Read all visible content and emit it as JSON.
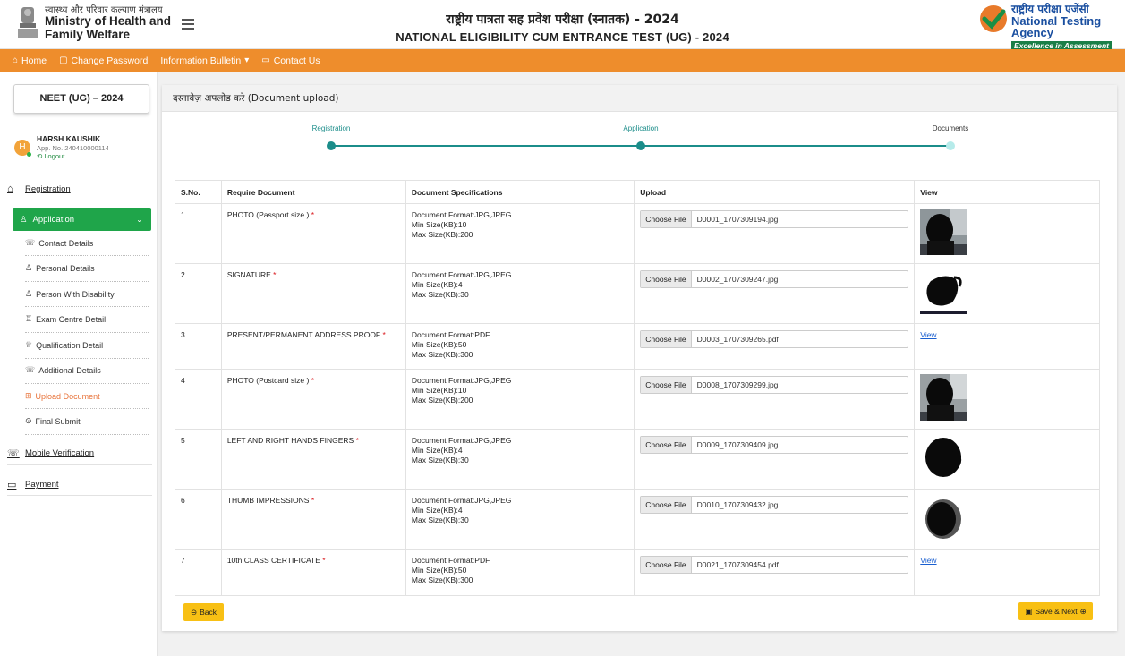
{
  "header": {
    "ministry_hi": "स्वास्थ्य और परिवार कल्याण मंत्रालय",
    "ministry_en1": "Ministry of Health and",
    "ministry_en2": "Family Welfare",
    "title_hi": "राष्ट्रीय पात्रता सह प्रवेश परीक्षा (स्नातक) - 2024",
    "title_en": "NATIONAL ELIGIBILITY CUM ENTRANCE TEST (UG) - 2024",
    "nta_hi": "राष्ट्रीय परीक्षा एजेंसी",
    "nta_en": "National Testing Agency",
    "nta_tagline": "Excellence in Assessment"
  },
  "topnav": {
    "home": "Home",
    "change_password": "Change Password",
    "info_bulletin": "Information Bulletin",
    "contact_us": "Contact Us"
  },
  "sidebar": {
    "exam_title": "NEET (UG) – 2024",
    "user_initial": "H",
    "user_name": "HARSH KAUSHIK",
    "app_no": "App. No. 240410000114",
    "logout": "Logout",
    "registration": "Registration",
    "application": "Application",
    "sub_items": [
      {
        "label": "Contact Details"
      },
      {
        "label": "Personal Details"
      },
      {
        "label": "Person With Disability"
      },
      {
        "label": "Exam Centre Detail"
      },
      {
        "label": "Qualification Detail"
      },
      {
        "label": "Additional Details"
      },
      {
        "label": "Upload Document"
      },
      {
        "label": "Final Submit"
      }
    ],
    "mobile_verification": "Mobile Verification",
    "payment": "Payment"
  },
  "page": {
    "heading": "दस्तावेज़ अपलोड करे (Document upload)",
    "steps": [
      "Registration",
      "Application",
      "Documents"
    ],
    "colors": {
      "accent_green": "#1fa54a",
      "nav_orange": "#ee8d2c",
      "step_teal": "#1b8d8a",
      "button_yellow": "#f8c014"
    },
    "table": {
      "headers": [
        "S.No.",
        "Require Document",
        "Document Specifications",
        "Upload",
        "View"
      ],
      "choose_file_label": "Choose File",
      "view_label": "View",
      "rows": [
        {
          "sno": "1",
          "doc": "PHOTO (Passport size )",
          "spec1": "Document Format:JPG,JPEG",
          "spec2": "Min Size(KB):10",
          "spec3": "Max Size(KB):200",
          "file": "D0001_1707309194.jpg",
          "view": "image"
        },
        {
          "sno": "2",
          "doc": "SIGNATURE",
          "spec1": "Document Format:JPG,JPEG",
          "spec2": "Min Size(KB):4",
          "spec3": "Max Size(KB):30",
          "file": "D0002_1707309247.jpg",
          "view": "image"
        },
        {
          "sno": "3",
          "doc": "PRESENT/PERMANENT ADDRESS PROOF",
          "spec1": "Document Format:PDF",
          "spec2": "Min Size(KB):50",
          "spec3": "Max Size(KB):300",
          "file": "D0003_1707309265.pdf",
          "view": "link"
        },
        {
          "sno": "4",
          "doc": "PHOTO (Postcard size )",
          "spec1": "Document Format:JPG,JPEG",
          "spec2": "Min Size(KB):10",
          "spec3": "Max Size(KB):200",
          "file": "D0008_1707309299.jpg",
          "view": "image"
        },
        {
          "sno": "5",
          "doc": "LEFT AND RIGHT HANDS FINGERS",
          "spec1": "Document Format:JPG,JPEG",
          "spec2": "Min Size(KB):4",
          "spec3": "Max Size(KB):30",
          "file": "D0009_1707309409.jpg",
          "view": "image"
        },
        {
          "sno": "6",
          "doc": "THUMB IMPRESSIONS",
          "spec1": "Document Format:JPG,JPEG",
          "spec2": "Min Size(KB):4",
          "spec3": "Max Size(KB):30",
          "file": "D0010_1707309432.jpg",
          "view": "image"
        },
        {
          "sno": "7",
          "doc": "10th CLASS CERTIFICATE",
          "spec1": "Document Format:PDF",
          "spec2": "Min Size(KB):50",
          "spec3": "Max Size(KB):300",
          "file": "D0021_1707309454.pdf",
          "view": "link"
        }
      ]
    },
    "back_label": "Back",
    "save_next_label": "Save & Next"
  }
}
